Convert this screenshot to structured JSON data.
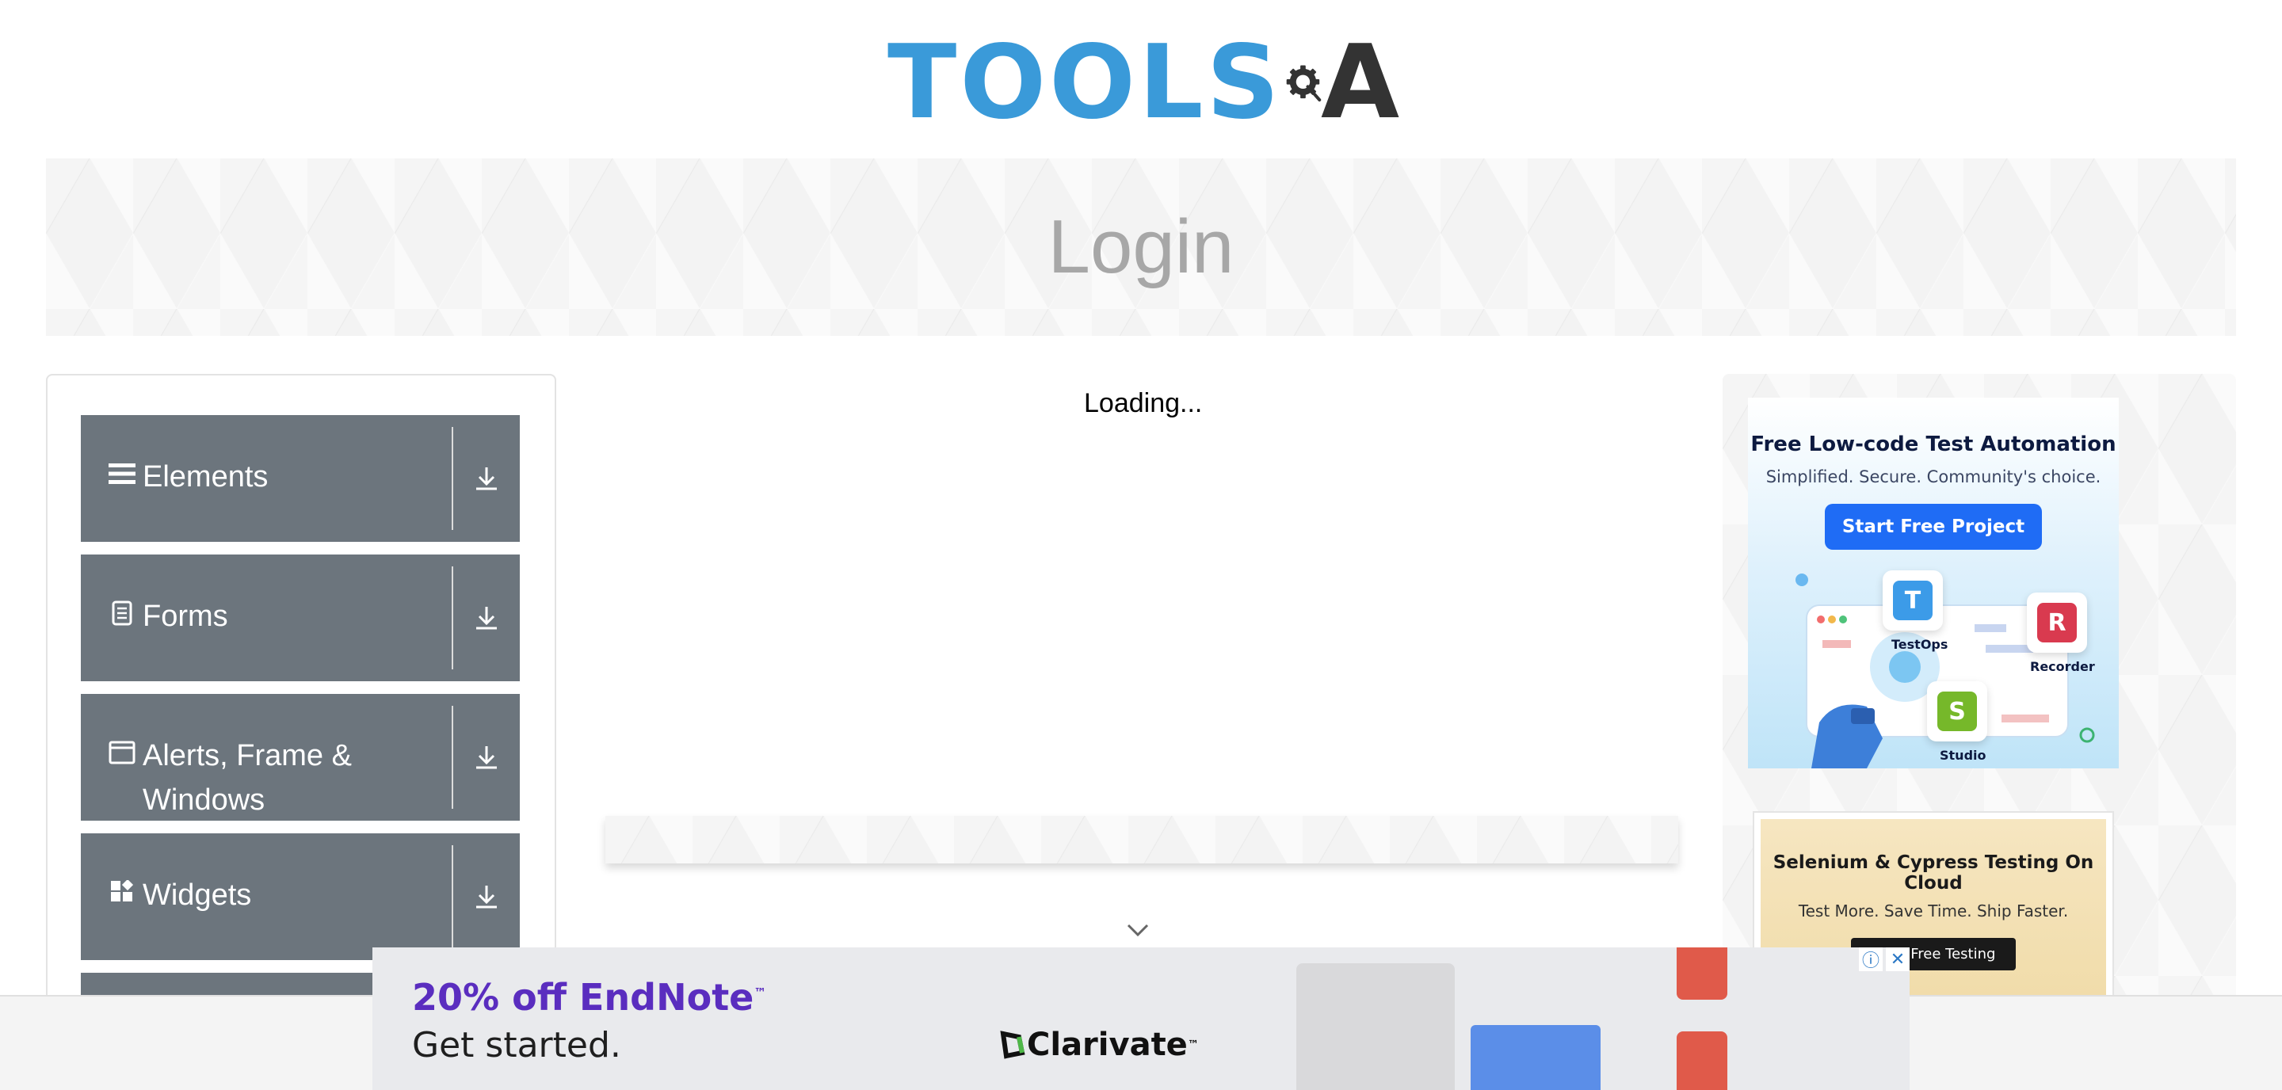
{
  "header": {
    "logo_text_left": "TOOLS",
    "logo_text_right": "A"
  },
  "banner": {
    "title": "Login"
  },
  "sidebar": {
    "groups": [
      {
        "label": "Elements",
        "icon": "hamburger-icon"
      },
      {
        "label": "Forms",
        "icon": "document-icon"
      },
      {
        "label": "Alerts, Frame &",
        "label_line2": "Windows",
        "icon": "window-icon"
      },
      {
        "label": "Widgets",
        "icon": "widgets-icon"
      }
    ]
  },
  "main": {
    "loading_text": "Loading..."
  },
  "ads": {
    "katalon": {
      "title": "Free Low-code Test Automation",
      "subtitle": "Simplified. Secure. Community's choice.",
      "button": "Start Free Project",
      "products": [
        "TestOps",
        "Recorder",
        "Studio"
      ],
      "product_letters": [
        "T",
        "R",
        "S"
      ]
    },
    "lambdatest": {
      "title": "Selenium & Cypress Testing On Cloud",
      "subtitle": "Test More. Save Time. Ship Faster.",
      "button": "Start Free Testing"
    },
    "endnote": {
      "promo": "20% off EndNote",
      "promo_mark": "™",
      "cta": "Get started.",
      "brand": "Clarivate",
      "brand_mark": "™"
    }
  },
  "colors": {
    "sidebar_group_bg": "#6c757d",
    "logo_blue": "#3a9ad9",
    "banner_title": "#a7a7a7",
    "endnote_purple": "#5a2dbf"
  }
}
